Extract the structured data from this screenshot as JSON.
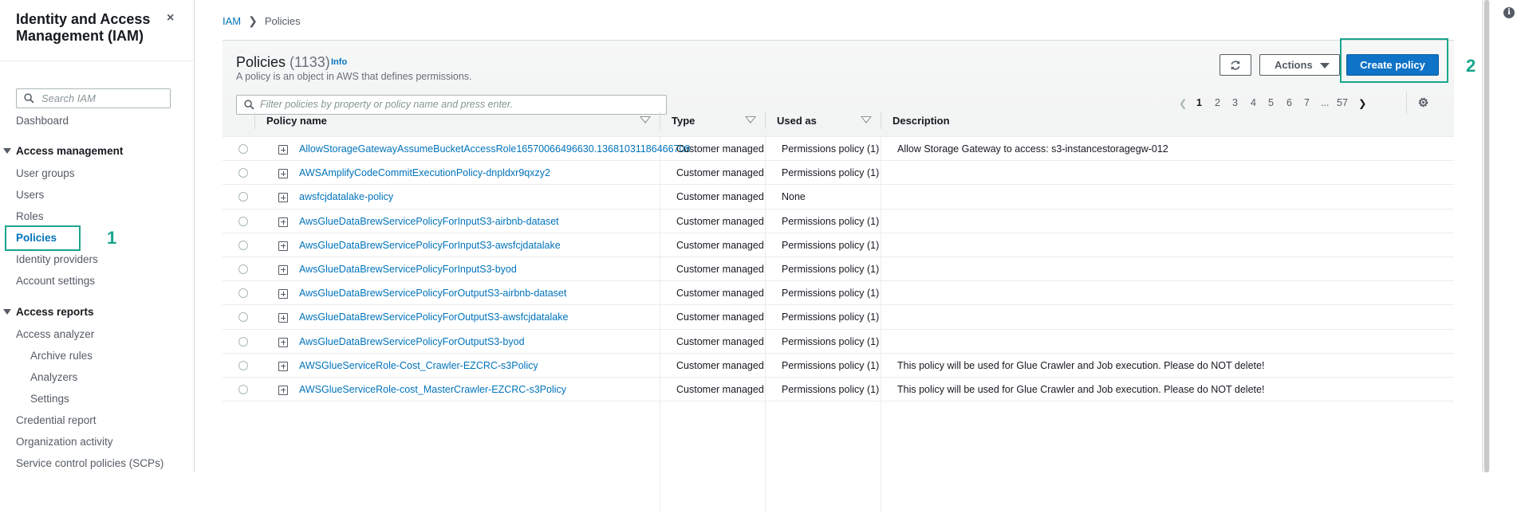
{
  "sidebar": {
    "title": "Identity and Access Management (IAM)",
    "close_icon": "×",
    "search_placeholder": "Search IAM",
    "dashboard": "Dashboard",
    "access_management": {
      "heading": "Access management",
      "items": [
        "User groups",
        "Users",
        "Roles",
        "Policies",
        "Identity providers",
        "Account settings"
      ]
    },
    "access_reports": {
      "heading": "Access reports",
      "items": [
        "Access analyzer",
        "Archive rules",
        "Analyzers",
        "Settings",
        "Credential report",
        "Organization activity",
        "Service control policies (SCPs)"
      ]
    },
    "active_item": "Policies"
  },
  "annotations": {
    "step1": "1",
    "step2": "2",
    "color": "#1aa58c"
  },
  "breadcrumb": {
    "root": "IAM",
    "current": "Policies"
  },
  "header": {
    "title": "Policies",
    "count": "(1133)",
    "info": "Info",
    "description": "A policy is an object in AWS that defines permissions.",
    "actions_label": "Actions",
    "create_label": "Create policy"
  },
  "filter": {
    "placeholder": "Filter policies by property or policy name and press enter."
  },
  "pagination": {
    "pages": [
      "1",
      "2",
      "3",
      "4",
      "5",
      "6",
      "7",
      "...",
      "57"
    ],
    "current": "1"
  },
  "table": {
    "columns": [
      "Policy name",
      "Type",
      "Used as",
      "Description"
    ],
    "rows": [
      {
        "name": "AllowStorageGatewayAssumeBucketAccessRole16570066496630.13681031186466708",
        "type": "Customer managed",
        "used": "Permissions policy (1)",
        "desc": "Allow Storage Gateway to access: s3-instancestoragegw-012"
      },
      {
        "name": "AWSAmplifyCodeCommitExecutionPolicy-dnpldxr9qxzy2",
        "type": "Customer managed",
        "used": "Permissions policy (1)",
        "desc": ""
      },
      {
        "name": "awsfcjdatalake-policy",
        "type": "Customer managed",
        "used": "None",
        "desc": ""
      },
      {
        "name": "AwsGlueDataBrewServicePolicyForInputS3-airbnb-dataset",
        "type": "Customer managed",
        "used": "Permissions policy (1)",
        "desc": ""
      },
      {
        "name": "AwsGlueDataBrewServicePolicyForInputS3-awsfcjdatalake",
        "type": "Customer managed",
        "used": "Permissions policy (1)",
        "desc": ""
      },
      {
        "name": "AwsGlueDataBrewServicePolicyForInputS3-byod",
        "type": "Customer managed",
        "used": "Permissions policy (1)",
        "desc": ""
      },
      {
        "name": "AwsGlueDataBrewServicePolicyForOutputS3-airbnb-dataset",
        "type": "Customer managed",
        "used": "Permissions policy (1)",
        "desc": ""
      },
      {
        "name": "AwsGlueDataBrewServicePolicyForOutputS3-awsfcjdatalake",
        "type": "Customer managed",
        "used": "Permissions policy (1)",
        "desc": ""
      },
      {
        "name": "AwsGlueDataBrewServicePolicyForOutputS3-byod",
        "type": "Customer managed",
        "used": "Permissions policy (1)",
        "desc": ""
      },
      {
        "name": "AWSGlueServiceRole-Cost_Crawler-EZCRC-s3Policy",
        "type": "Customer managed",
        "used": "Permissions policy (1)",
        "desc": "This policy will be used for Glue Crawler and Job execution. Please do NOT delete!"
      },
      {
        "name": "AWSGlueServiceRole-cost_MasterCrawler-EZCRC-s3Policy",
        "type": "Customer managed",
        "used": "Permissions policy (1)",
        "desc": "This policy will be used for Glue Crawler and Job execution. Please do NOT delete!"
      }
    ]
  },
  "colors": {
    "link": "#0073bb",
    "primary_button": "#0f73c7",
    "highlight": "#1aa58c"
  }
}
